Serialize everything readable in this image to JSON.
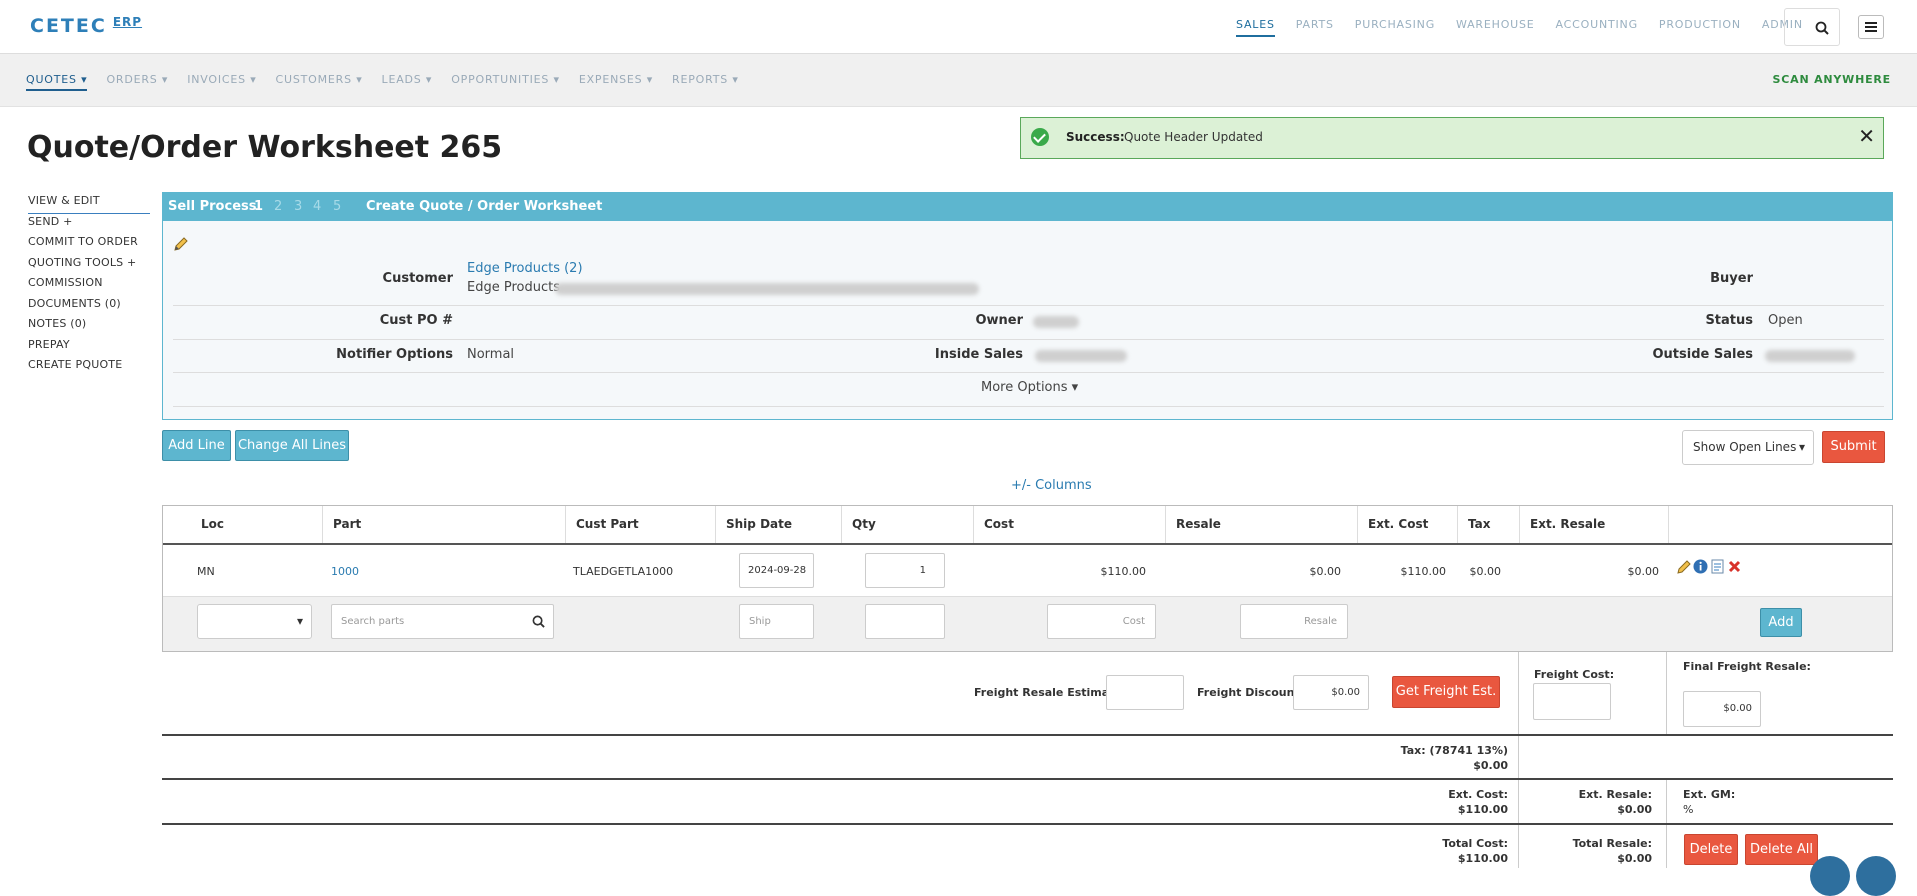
{
  "brand": {
    "name": "CETEC",
    "suffix": "ERP"
  },
  "main_nav": [
    "SALES",
    "PARTS",
    "PURCHASING",
    "WAREHOUSE",
    "ACCOUNTING",
    "PRODUCTION",
    "ADMIN"
  ],
  "sub_nav": [
    "QUOTES ▾",
    "ORDERS ▾",
    "INVOICES ▾",
    "CUSTOMERS ▾",
    "LEADS ▾",
    "OPPORTUNITIES ▾",
    "EXPENSES ▾",
    "REPORTS ▾"
  ],
  "scan_anywhere": "SCAN ANYWHERE",
  "page_title": "Quote/Order Worksheet 265",
  "toast": {
    "label": "Success:",
    "message": "Quote Header Updated",
    "close": "✕"
  },
  "side_nav": [
    "VIEW & EDIT",
    "SEND +",
    "COMMIT TO ORDER",
    "QUOTING TOOLS +",
    "COMMISSION",
    "DOCUMENTS (0)",
    "NOTES (0)",
    "PREPAY",
    "CREATE PQUOTE"
  ],
  "sell_process": {
    "label": "Sell Process",
    "steps": [
      "1",
      "2",
      "3",
      "4",
      "5"
    ],
    "title": "Create Quote / Order Worksheet"
  },
  "header": {
    "customer_label": "Customer",
    "customer_link": "Edge Products (2)",
    "customer_name": "Edge Products",
    "buyer_label": "Buyer",
    "cust_po_label": "Cust PO #",
    "owner_label": "Owner",
    "status_label": "Status",
    "status_value": "Open",
    "notifier_label": "Notifier Options",
    "notifier_value": "Normal",
    "inside_sales_label": "Inside Sales",
    "outside_sales_label": "Outside Sales",
    "more_options": "More Options ▾"
  },
  "actions": {
    "add_line": "Add Line",
    "change_all": "Change All Lines",
    "show_lines": "Show Open Lines",
    "submit": "Submit",
    "columns": "+/- Columns"
  },
  "table": {
    "headers": [
      "Loc",
      "Part",
      "Cust Part",
      "Ship Date",
      "Qty",
      "Cost",
      "Resale",
      "Ext. Cost",
      "Tax",
      "Ext. Resale"
    ],
    "row": {
      "loc": "MN",
      "part": "1000",
      "cust_part": "TLAEDGETLA1000",
      "ship_date": "2024-09-28",
      "qty": "1",
      "cost": "$110.00",
      "resale": "$0.00",
      "ext_cost": "$110.00",
      "tax": "$0.00",
      "ext_resale": "$0.00"
    },
    "add_row": {
      "search_placeholder": "Search parts",
      "ship_placeholder": "Ship",
      "cost_placeholder": "Cost",
      "resale_placeholder": "Resale",
      "add": "Add"
    }
  },
  "freight": {
    "resale_est_label": "Freight Resale Estimate:",
    "discount_label": "Freight Discount:",
    "discount_value": "$0.00",
    "get_est": "Get Freight Est.",
    "cost_label": "Freight Cost:",
    "final_label": "Final Freight Resale:",
    "final_value": "$0.00"
  },
  "totals": {
    "tax_label": "Tax: (78741 13%)",
    "tax_value": "$0.00",
    "ext_cost_label": "Ext. Cost:",
    "ext_cost_value": "$110.00",
    "ext_resale_label": "Ext. Resale:",
    "ext_resale_value": "$0.00",
    "ext_gm_label": "Ext. GM:",
    "ext_gm_value": "%",
    "total_cost_label": "Total Cost:",
    "total_cost_value": "$110.00",
    "total_resale_label": "Total Resale:",
    "total_resale_value": "$0.00",
    "delete": "Delete",
    "delete_all": "Delete All"
  }
}
